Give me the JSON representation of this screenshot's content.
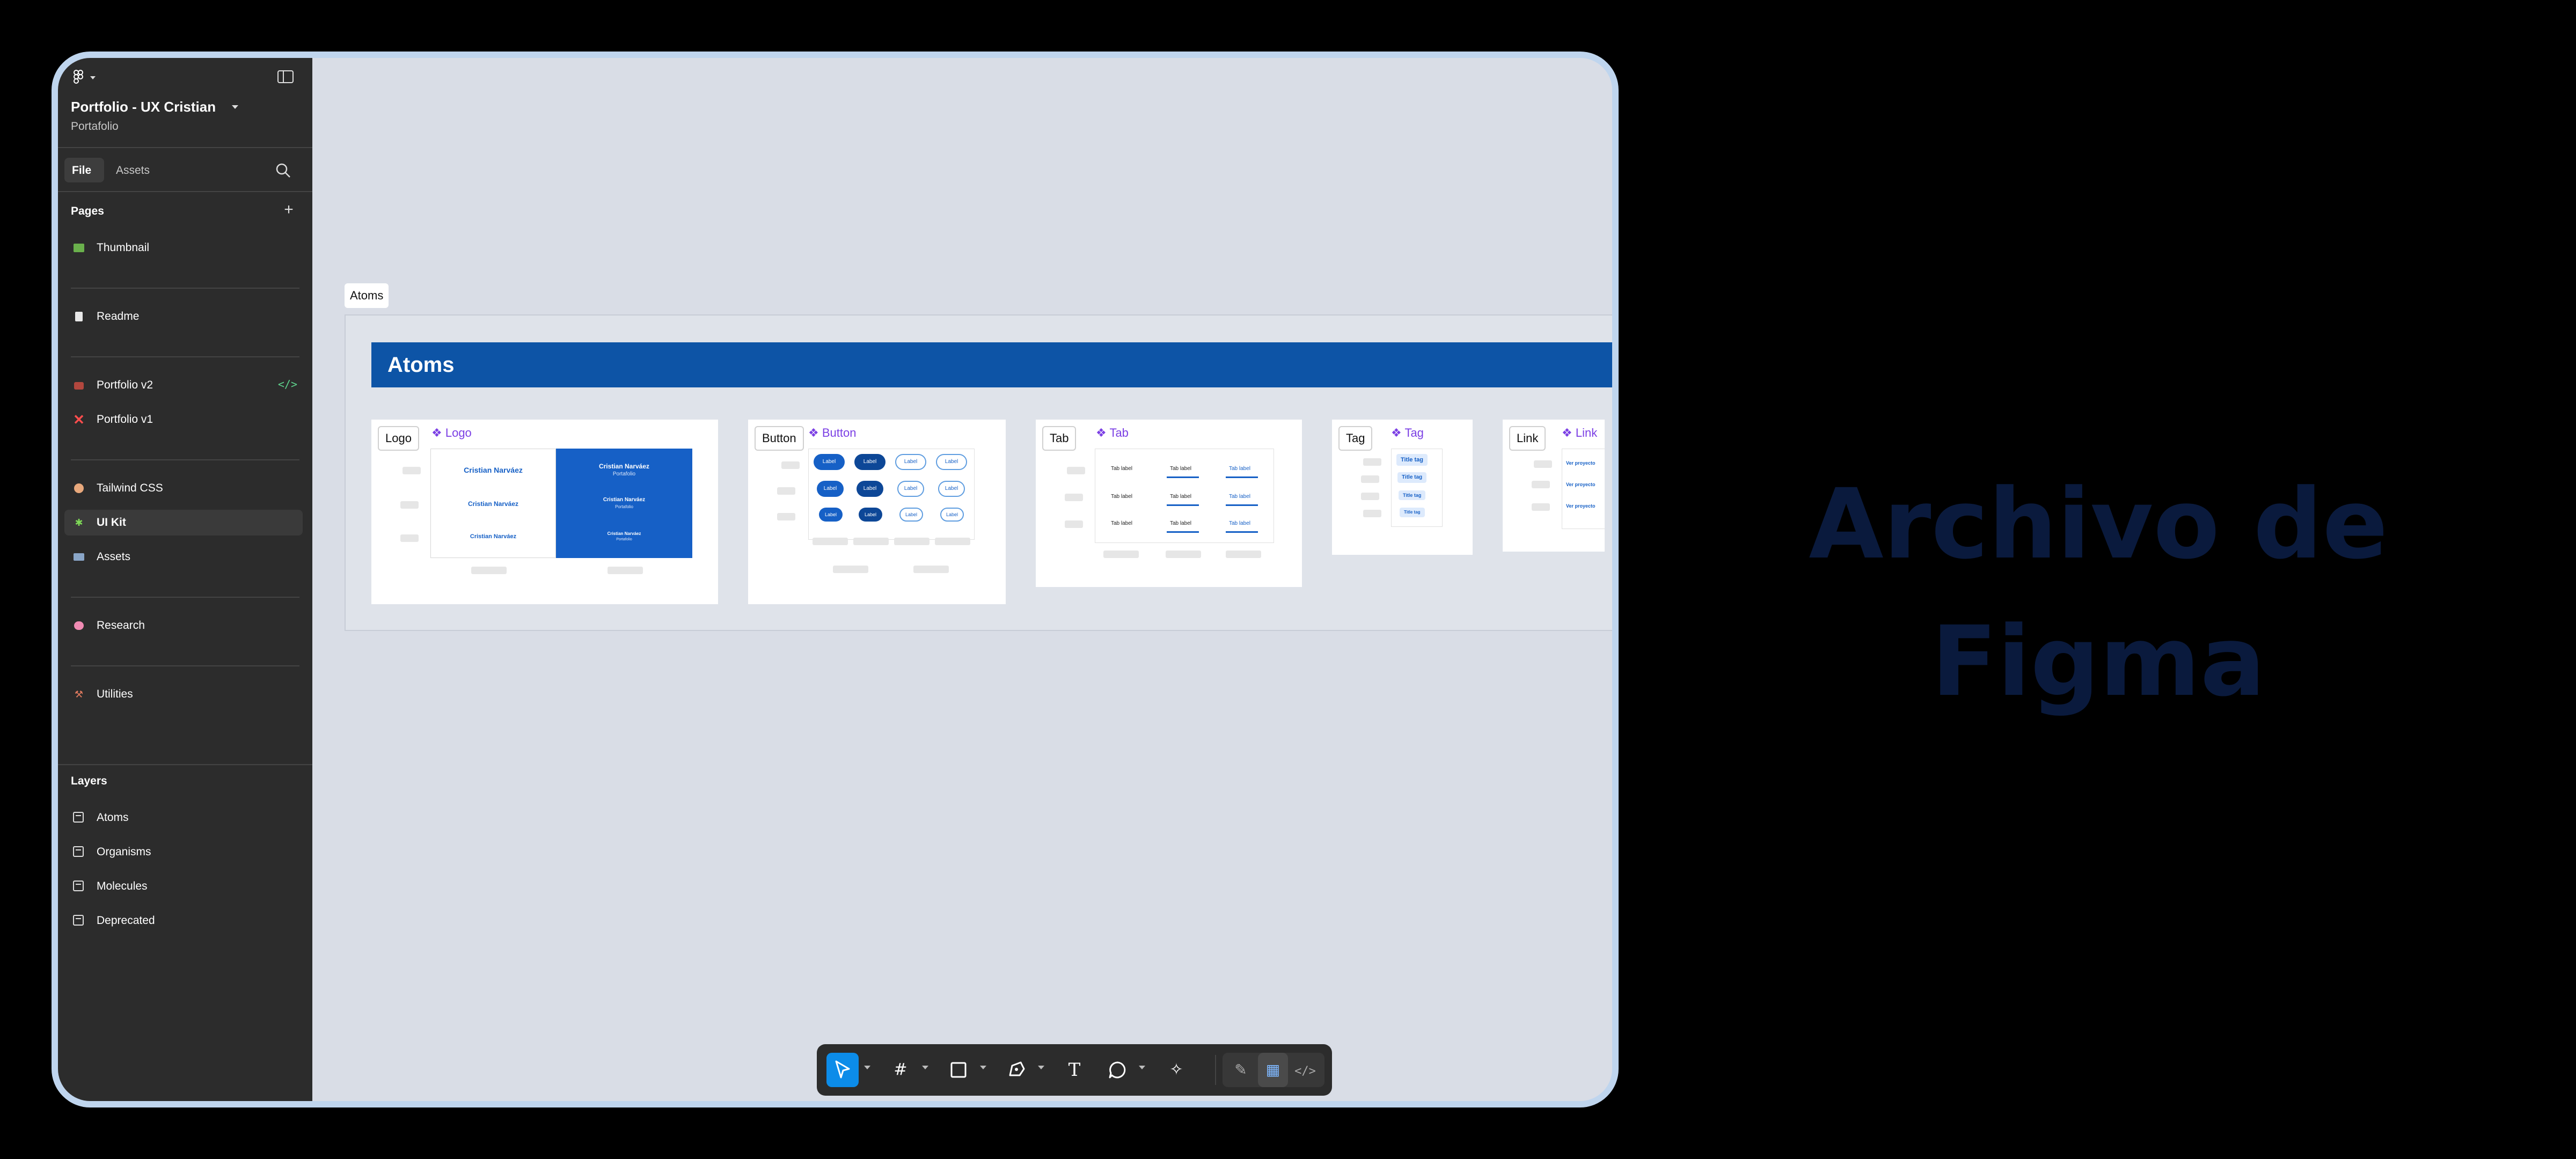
{
  "sidebar": {
    "file_name": "Portfolio - UX Cristian",
    "project_name": "Portafolio",
    "tabs": [
      {
        "label": "File"
      },
      {
        "label": "Assets"
      }
    ],
    "pages_heading": "Pages",
    "pages": [
      {
        "label": "Thumbnail",
        "icon": "image-icon"
      },
      {
        "label": "Readme",
        "icon": "document-icon"
      },
      {
        "label": "Portfolio v2",
        "icon": "briefcase-icon"
      },
      {
        "label": "Portfolio v1",
        "icon": "cross-icon"
      },
      {
        "label": "Tailwind CSS",
        "icon": "palette-icon"
      },
      {
        "label": "UI Kit",
        "icon": "puzzle-icon"
      },
      {
        "label": "Assets",
        "icon": "card-icon"
      },
      {
        "label": "Research",
        "icon": "brain-icon"
      },
      {
        "label": "Utilities",
        "icon": "tools-icon"
      }
    ],
    "selected_page": "UI Kit",
    "layers_heading": "Layers",
    "layers": [
      {
        "label": "Atoms"
      },
      {
        "label": "Organisms"
      },
      {
        "label": "Molecules"
      },
      {
        "label": "Deprecated"
      }
    ]
  },
  "canvas": {
    "section_label": "Atoms",
    "section_title": "Atoms",
    "cards": {
      "logo": {
        "tag": "Logo",
        "title": "Logo",
        "logo_text": "Cristian Narváez",
        "logo_sub": "Portafolio"
      },
      "button": {
        "tag": "Button",
        "title": "Button",
        "chip_label": "Label"
      },
      "tab": {
        "tag": "Tab",
        "title": "Tab",
        "cell_label": "Tab label"
      },
      "tag": {
        "tag": "Tag",
        "title": "Tag",
        "pill_label": "Title tag"
      },
      "link": {
        "tag": "Link",
        "title": "Link",
        "link_label": "Ver proyecto"
      }
    }
  },
  "toolbar": {
    "tools": [
      {
        "name": "move-tool",
        "icon": "cursor-icon",
        "active": true
      },
      {
        "name": "frame-tool",
        "icon": "frame-icon"
      },
      {
        "name": "shape-tool",
        "icon": "rectangle-icon"
      },
      {
        "name": "pen-tool",
        "icon": "pen-icon"
      },
      {
        "name": "text-tool",
        "icon": "text-icon"
      },
      {
        "name": "comment-tool",
        "icon": "comment-icon"
      },
      {
        "name": "actions-tool",
        "icon": "sparkle-icon"
      },
      {
        "name": "draw-mode",
        "icon": "draw-icon"
      },
      {
        "name": "design-mode",
        "icon": "design-icon"
      },
      {
        "name": "dev-mode",
        "icon": "code-icon"
      }
    ]
  },
  "headline": "Archivo de Figma",
  "colors": {
    "accent": "#0c8ce9",
    "section_header": "#0d54a6",
    "component_purple": "#7b3fe4",
    "headline": "#0a1a3d",
    "frame_border": "#bfd5ee"
  }
}
